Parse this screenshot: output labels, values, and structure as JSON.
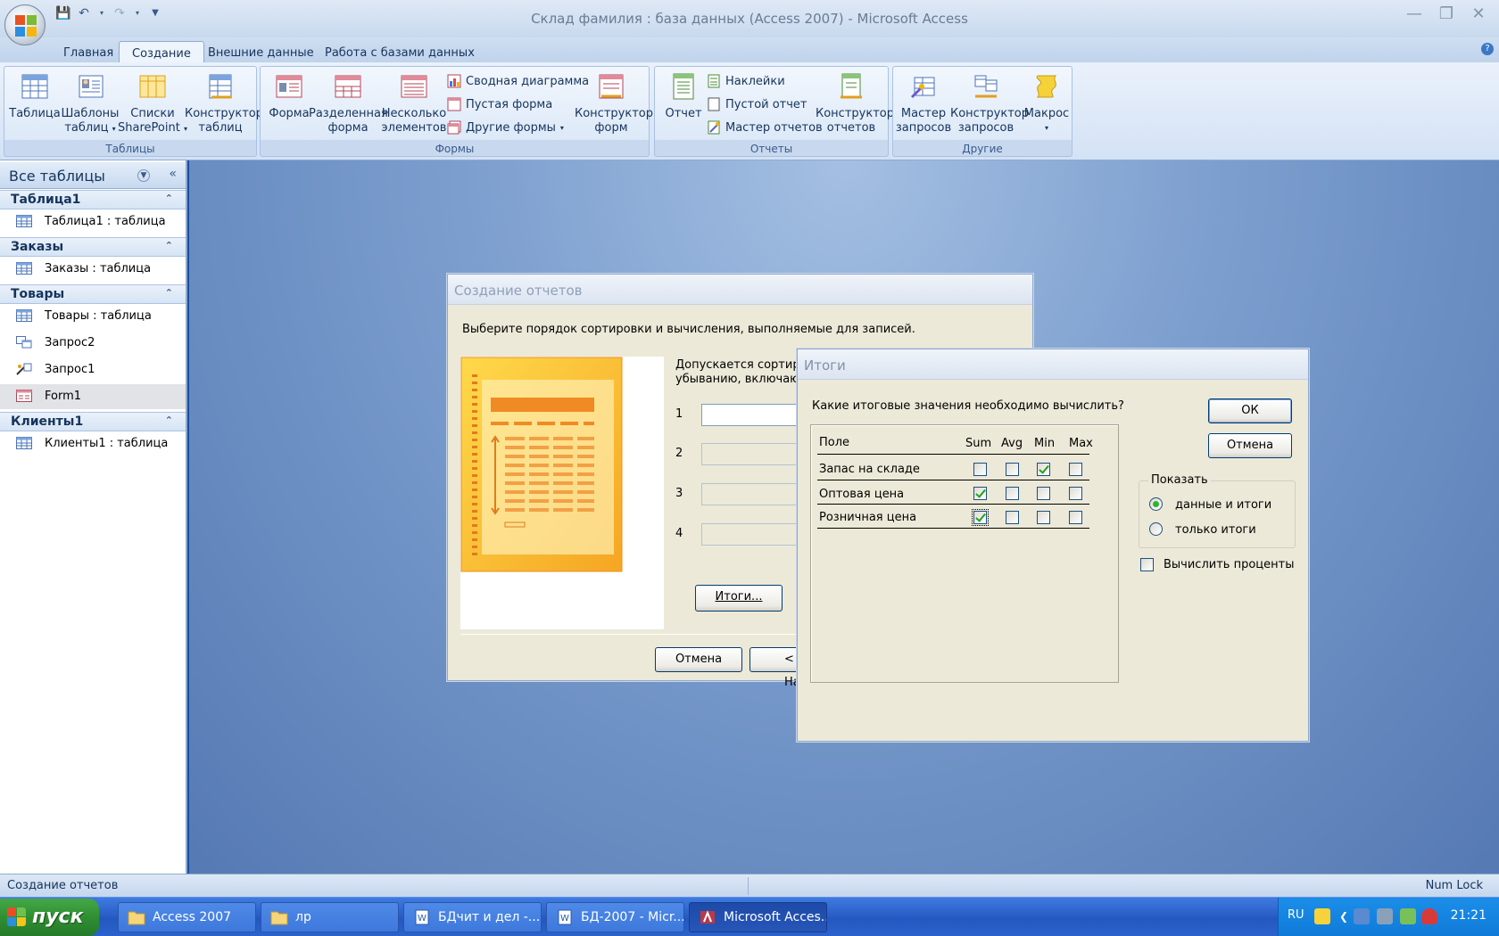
{
  "window": {
    "title": "Склад фамилия : база данных (Access 2007) - Microsoft Access"
  },
  "ribbon_tabs": [
    "Главная",
    "Создание",
    "Внешние данные",
    "Работа с базами данных"
  ],
  "ribbon": {
    "tables": {
      "label": "Таблицы",
      "table": "Таблица",
      "templates_1": "Шаблоны",
      "templates_2": "таблиц",
      "lists_1": "Списки",
      "lists_2": "SharePoint",
      "designer_1": "Конструктор",
      "designer_2": "таблиц"
    },
    "forms": {
      "label": "Формы",
      "form": "Форма",
      "split_1": "Разделенная",
      "split_2": "форма",
      "multi_1": "Несколько",
      "multi_2": "элементов",
      "pivot_chart": "Сводная диаграмма",
      "blank_form": "Пустая форма",
      "other_forms": "Другие формы",
      "designer_1": "Конструктор",
      "designer_2": "форм"
    },
    "reports": {
      "label": "Отчеты",
      "report": "Отчет",
      "labels": "Наклейки",
      "blank_report": "Пустой отчет",
      "wizard": "Мастер отчетов",
      "designer_1": "Конструктор",
      "designer_2": "отчетов"
    },
    "other": {
      "label": "Другие",
      "qwiz_1": "Мастер",
      "qwiz_2": "запросов",
      "qdes_1": "Конструктор",
      "qdes_2": "запросов",
      "macro": "Макрос"
    }
  },
  "nav": {
    "title": "Все таблицы",
    "groups": [
      {
        "name": "Таблица1",
        "items": [
          "Таблица1 : таблица"
        ]
      },
      {
        "name": "Заказы",
        "items": [
          "Заказы : таблица"
        ]
      },
      {
        "name": "Товары",
        "items": [
          "Товары : таблица",
          "Запрос2",
          "Запрос1",
          "Form1"
        ]
      },
      {
        "name": "Клиенты1",
        "items": [
          "Клиенты1 : таблица"
        ]
      }
    ]
  },
  "wizard": {
    "title": "Создание отчетов",
    "prompt": "Выберите порядок сортировки и вычисления, выполняемые для записей.",
    "desc_1": "Допускается сортировк",
    "desc_2": "убыванию, включающа",
    "sort_numbers": [
      "1",
      "2",
      "3",
      "4"
    ],
    "summary_button": "Итоги...",
    "cancel": "Отмена",
    "back": "< На"
  },
  "totals": {
    "title": "Итоги",
    "question": "Какие итоговые значения необходимо вычислить?",
    "columns": [
      "Поле",
      "Sum",
      "Avg",
      "Min",
      "Max"
    ],
    "rows": [
      {
        "field": "Запас на складе",
        "sum": false,
        "avg": false,
        "min": true,
        "max": false
      },
      {
        "field": "Оптовая цена",
        "sum": true,
        "avg": false,
        "min": false,
        "max": false
      },
      {
        "field": "Розничная цена",
        "sum": true,
        "avg": false,
        "min": false,
        "max": false
      }
    ],
    "ok": "ОК",
    "cancel": "Отмена",
    "show_label": "Показать",
    "opt_detail": "данные и итоги",
    "opt_summary": "только итоги",
    "percent": "Вычислить проценты"
  },
  "status": {
    "left": "Создание отчетов",
    "right": "Num Lock"
  },
  "taskbar": {
    "start": "пуск",
    "items": [
      "Access 2007",
      "лр",
      "БДчит и дел -...",
      "БД-2007 - Micr...",
      "Microsoft Acces..."
    ],
    "lang": "RU",
    "clock": "21:21"
  }
}
